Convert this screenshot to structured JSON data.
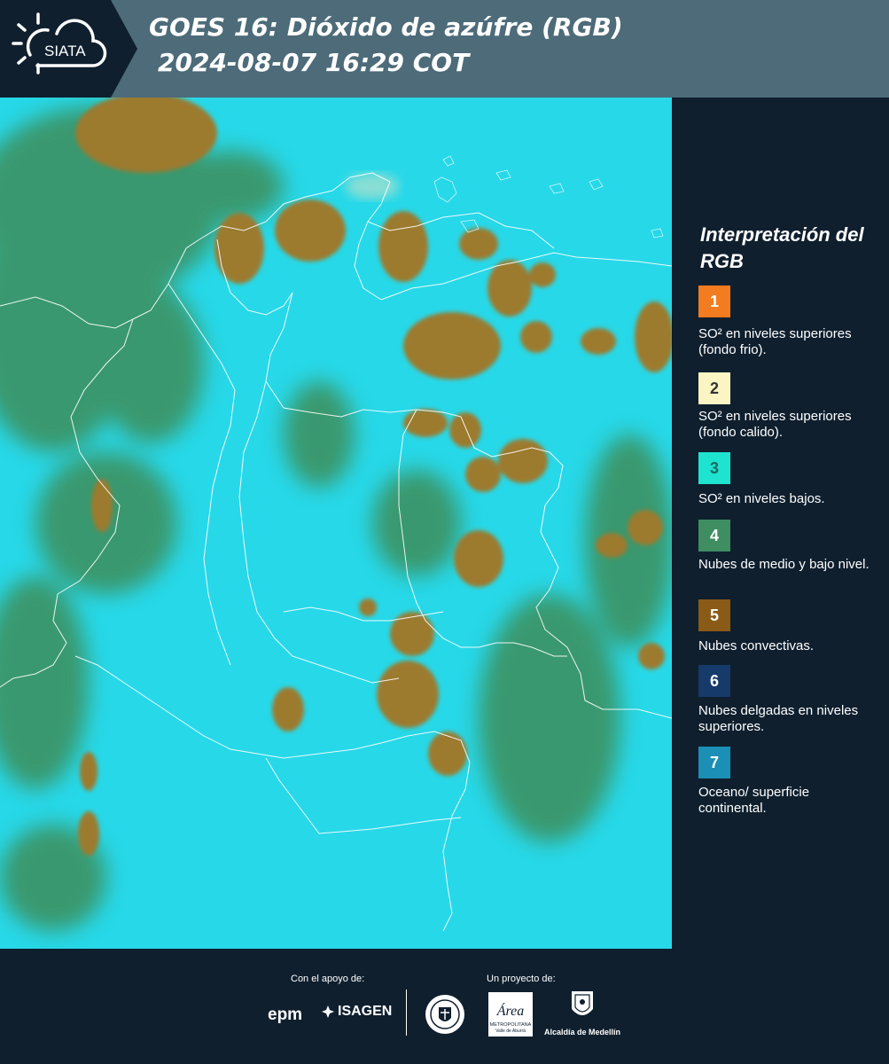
{
  "header": {
    "logo_text": "SIATA",
    "title_line1": "GOES 16: Dióxido de azúfre (RGB)",
    "title_line2": "2024-08-07 16:29 COT"
  },
  "legend": {
    "title": "Interpretación del RGB",
    "items": [
      {
        "number": "1",
        "label": "SO² en niveles superiores (fondo frio).",
        "color": "#f47c20",
        "text_color": "#ffffff"
      },
      {
        "number": "2",
        "label": "SO² en niveles superiores (fondo calido).",
        "color": "#fbf5c4",
        "text_color": "#333333"
      },
      {
        "number": "3",
        "label": "SO² en niveles bajos.",
        "color": "#1ee3cf",
        "text_color": "#1a6a63"
      },
      {
        "number": "4",
        "label": "Nubes de medio y bajo nivel.",
        "color": "#3e8e62",
        "text_color": "#ffffff"
      },
      {
        "number": "5",
        "label": "Nubes convectivas.",
        "color": "#8a5a17",
        "text_color": "#ffffff"
      },
      {
        "number": "6",
        "label": "Nubes delgadas en niveles superiores.",
        "color": "#163a6a",
        "text_color": "#ffffff"
      },
      {
        "number": "7",
        "label": "Oceano/ superficie continental.",
        "color": "#1b8fb5",
        "text_color": "#ffffff"
      }
    ]
  },
  "map": {
    "ocean_color": "#27d8e8",
    "cloud_color": "#9c7a2e",
    "low_cloud_color": "#3d8e5a",
    "border_color": "#ffffff"
  },
  "footer": {
    "support_label": "Con el apoyo de:",
    "project_label": "Un proyecto de:",
    "epm_text": "epm",
    "isagen_text": "ISAGEN",
    "area_text": "Área",
    "area_subtext": "METROPOLITANA",
    "area_subtext2": "Valle de Aburrá",
    "alcaldia_text": "Alcaldía de Medellín"
  }
}
